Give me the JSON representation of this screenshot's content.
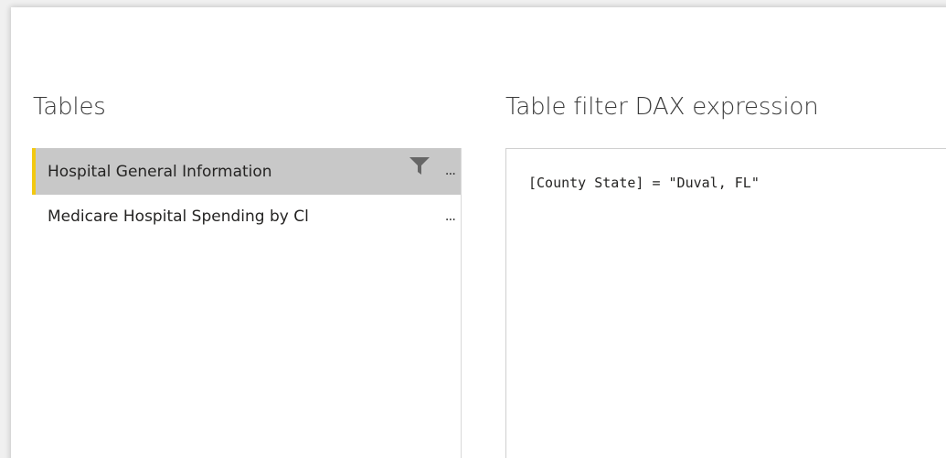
{
  "tables_section": {
    "heading": "Tables",
    "items": [
      {
        "label": "Hospital General Information",
        "selected": true,
        "has_filter": true,
        "more": "..."
      },
      {
        "label": "Medicare Hospital Spending by Cl",
        "selected": false,
        "has_filter": false,
        "more": "..."
      }
    ]
  },
  "dax_section": {
    "heading": "Table filter DAX expression",
    "expression": "[County State] = \"Duval, FL\""
  },
  "colors": {
    "selected_accent": "#f2c811",
    "selected_background": "#c8c8c8",
    "filter_icon": "#666666"
  },
  "icons": {
    "filter": "filter-funnel-icon"
  }
}
